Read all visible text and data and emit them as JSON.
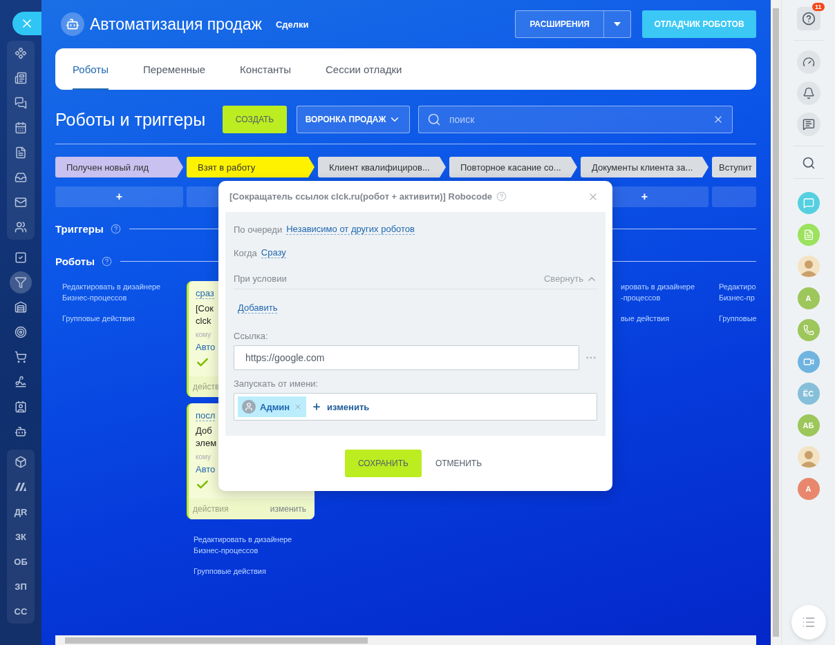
{
  "left_nav": {
    "groups": [
      {
        "panel": true,
        "items": [
          {
            "kind": "icon",
            "selected": false
          },
          {
            "kind": "icon",
            "selected": false
          },
          {
            "kind": "icon",
            "selected": false
          },
          {
            "kind": "icon",
            "selected": false
          },
          {
            "kind": "icon",
            "selected": false
          },
          {
            "kind": "icon",
            "selected": false
          },
          {
            "kind": "icon",
            "selected": false
          },
          {
            "kind": "icon",
            "selected": false
          }
        ]
      },
      {
        "panel": false,
        "items": [
          {
            "kind": "icon",
            "selected": false
          },
          {
            "kind": "icon",
            "selected": true
          },
          {
            "kind": "icon",
            "selected": false
          },
          {
            "kind": "icon",
            "selected": false
          },
          {
            "kind": "icon",
            "selected": false
          },
          {
            "kind": "icon",
            "selected": false
          },
          {
            "kind": "icon",
            "selected": false
          },
          {
            "kind": "icon",
            "selected": false
          }
        ]
      },
      {
        "panel": true,
        "items": [
          {
            "kind": "icon",
            "selected": false
          },
          {
            "kind": "icon",
            "selected": false
          },
          {
            "kind": "initials",
            "label": "ДR",
            "selected": false
          },
          {
            "kind": "initials",
            "label": "ЗК",
            "selected": false
          },
          {
            "kind": "initials",
            "label": "ОБ",
            "selected": false
          },
          {
            "kind": "initials",
            "label": "ЗП",
            "selected": false
          },
          {
            "kind": "initials",
            "label": "СС",
            "selected": false
          }
        ]
      }
    ]
  },
  "header": {
    "title": "Автоматизация продаж",
    "subtitle": "Сделки",
    "extensions_button": "РАСШИРЕНИЯ",
    "debugger_button": "ОТЛАДЧИК РОБОТОВ"
  },
  "tabs": [
    {
      "label": "Роботы",
      "selected": true
    },
    {
      "label": "Переменные",
      "selected": false
    },
    {
      "label": "Константы",
      "selected": false
    },
    {
      "label": "Сессии отладки",
      "selected": false
    }
  ],
  "toolbar": {
    "heading": "Роботы и триггеры",
    "create_button": "СОЗДАТЬ",
    "funnel_button": "ВОРОНКА ПРОДАЖ",
    "search": {
      "placeholder": "поиск"
    }
  },
  "stages": [
    {
      "name": "Получен новый лид",
      "color": "#c9c1ef",
      "add": "+"
    },
    {
      "name": "Взят в работу",
      "color": "#fff200"
    },
    {
      "name": "Клиент квалифициров...",
      "color": "#d9dce1"
    },
    {
      "name": "Повторное касание со...",
      "color": "#d9dce1"
    },
    {
      "name": "Документы клиента за...",
      "color": "#d9dce1",
      "add": "+"
    },
    {
      "name": "Вступит",
      "color": "#d9dce1"
    }
  ],
  "sections": {
    "triggers": "Триггеры",
    "robots": "Роботы"
  },
  "columns": [
    {
      "kind": "full",
      "design_link": [
        "Редактировать в дизайнере",
        "Бизнес-процессов"
      ],
      "group_link": "Групповые действия"
    },
    {
      "kind": "full",
      "cards": [
        {
          "delay": "сраз",
          "title_lines": [
            "[Сок",
            "clck"
          ],
          "recipient": "кому",
          "status": "Авто",
          "done": true,
          "footer_left": "действ"
        },
        {
          "delay": "посл",
          "title_lines": [
            "Доб",
            "элем"
          ],
          "recipient": "кому",
          "status": "Авто",
          "done": true,
          "footer_left": "действия",
          "footer_right": "изменить"
        }
      ],
      "design_link": [
        "Редактировать в дизайнере",
        "Бизнес-процессов"
      ],
      "group_link": "Групповые действия"
    },
    {
      "kind": "hidden"
    },
    {
      "kind": "hidden"
    },
    {
      "kind": "partial",
      "design_link": [
        "ировать в дизайнере",
        "-процессов"
      ],
      "group_link": "вые действия"
    },
    {
      "kind": "full",
      "design_link": [
        "Редактиро",
        "Бизнес-пр"
      ],
      "group_link": "Групповые"
    }
  ],
  "modal": {
    "title": "[Сокращатель ссылок clck.ru(робот + активити)] Robocode",
    "queue_label": "По очереди",
    "queue_value": "Независимо от других роботов",
    "when_label": "Когда",
    "when_value": "Сразу",
    "condition_label": "При условии",
    "collapse_link": "Свернуть",
    "add_condition": "Добавить",
    "link_label": "Ссылка:",
    "link_value": "https://google.com",
    "run_as_label": "Запускать от имени:",
    "run_as_user": "Админ",
    "change_link": "изменить",
    "save_button": "СОХРАНИТЬ",
    "cancel_button": "ОТМЕНИТЬ"
  },
  "right_bar": {
    "help_badge": "11",
    "contacts": [
      {
        "kind": "chat",
        "color": "#55d0e0"
      },
      {
        "kind": "document",
        "color": "#9be25e"
      },
      {
        "kind": "photo"
      },
      {
        "kind": "initials",
        "label": "А",
        "color": "#9dc65b"
      },
      {
        "kind": "phone",
        "color": "#9dc65b"
      },
      {
        "kind": "video",
        "color": "#6fb4e0"
      },
      {
        "kind": "initials",
        "label": "ЁС",
        "color": "#86bfd9"
      },
      {
        "kind": "initials",
        "label": "АБ",
        "color": "#9dc65b"
      },
      {
        "kind": "photo"
      },
      {
        "kind": "initials",
        "label": "А",
        "color": "#e8876d"
      }
    ]
  }
}
